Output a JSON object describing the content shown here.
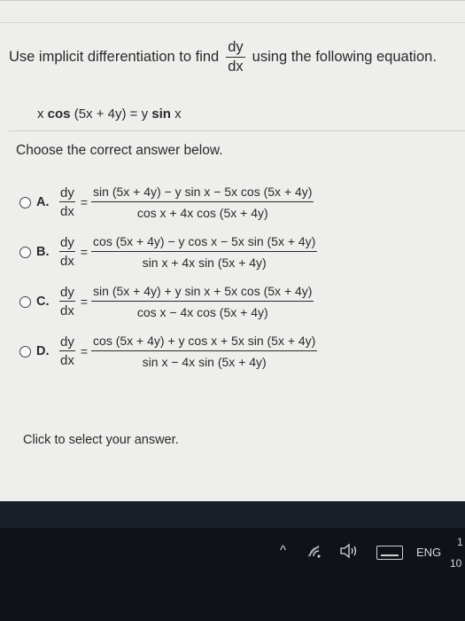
{
  "question": {
    "prefix": "Use implicit differentiation to find",
    "frac_num": "dy",
    "frac_den": "dx",
    "suffix": "using the following equation."
  },
  "equation": {
    "lhs": "x ",
    "cos": "cos",
    "mid": " (5x + 4y) = y ",
    "sin": "sin",
    "end": " x"
  },
  "prompt": "Choose the correct answer below.",
  "options": [
    {
      "letter": "A.",
      "dy": "dy",
      "dx": "dx",
      "eq": "=",
      "num": "sin (5x + 4y) − y sin x − 5x cos (5x + 4y)",
      "den": "cos x + 4x cos (5x + 4y)"
    },
    {
      "letter": "B.",
      "dy": "dy",
      "dx": "dx",
      "eq": "=",
      "num": "cos (5x + 4y) − y cos x − 5x sin (5x + 4y)",
      "den": "sin x + 4x sin (5x + 4y)"
    },
    {
      "letter": "C.",
      "dy": "dy",
      "dx": "dx",
      "eq": "=",
      "num": "sin (5x + 4y) + y sin x + 5x cos (5x + 4y)",
      "den": "cos x − 4x cos (5x + 4y)"
    },
    {
      "letter": "D.",
      "dy": "dy",
      "dx": "dx",
      "eq": "=",
      "num": "cos (5x + 4y) + y cos x + 5x sin (5x + 4y)",
      "den": "sin x − 4x sin (5x + 4y)"
    }
  ],
  "footer": "Click to select your answer.",
  "taskbar": {
    "chevron": "^",
    "wifi_icon": "wifi-icon",
    "volume_icon": "volume-icon",
    "keyboard_icon": "keyboard-icon",
    "language": "ENG",
    "clock_line1": "1",
    "clock_line2": "10"
  }
}
